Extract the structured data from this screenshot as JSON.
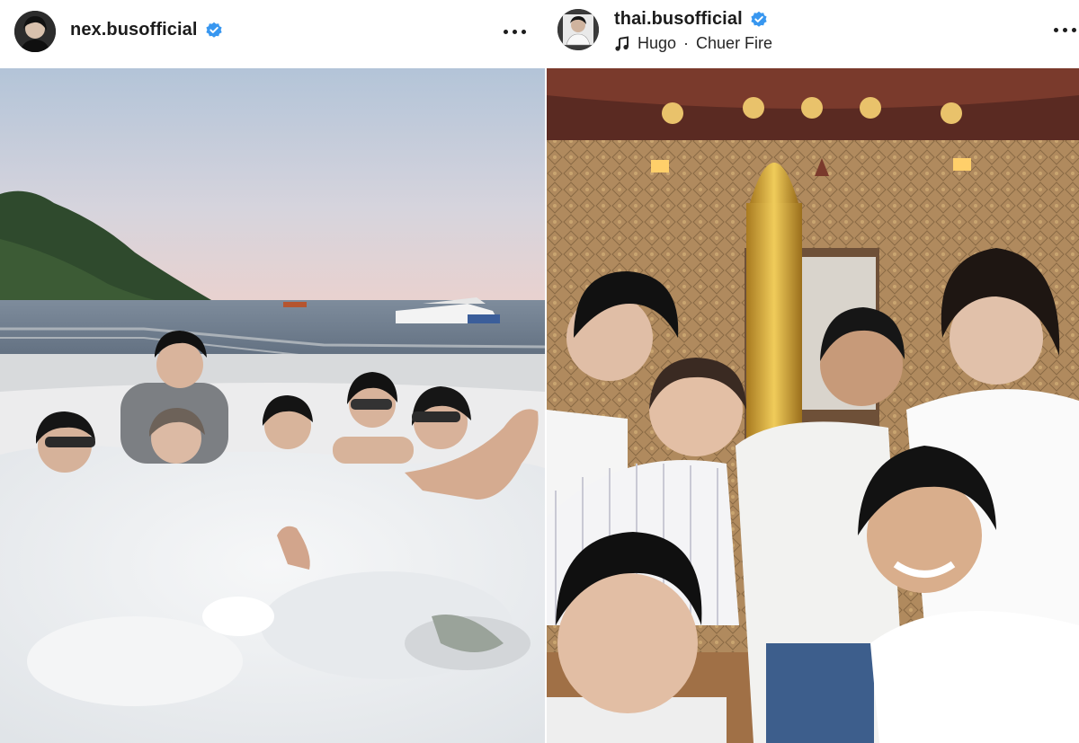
{
  "posts": [
    {
      "username": "nex.busofficial",
      "verified": true,
      "avatar_icon": "profile-avatar",
      "more_icon": "more-options-icon",
      "photo_description_icon": "hot-tub-photo"
    },
    {
      "username": "thai.busofficial",
      "verified": true,
      "avatar_icon": "profile-avatar",
      "music": {
        "icon": "music-note-icon",
        "artist": "Hugo",
        "separator": "·",
        "track": "Chuer Fire"
      },
      "more_icon": "more-options-icon",
      "photo_description_icon": "temple-selfie-photo"
    }
  ],
  "colors": {
    "verified_badge": "#3897f0",
    "text": "#1c1c1c",
    "sky_top": "#b7c7d9",
    "sea": "#6e7d8e",
    "foam": "#eef0f2",
    "temple_wall": "#b08a5c",
    "gold": "#d4a73c"
  }
}
